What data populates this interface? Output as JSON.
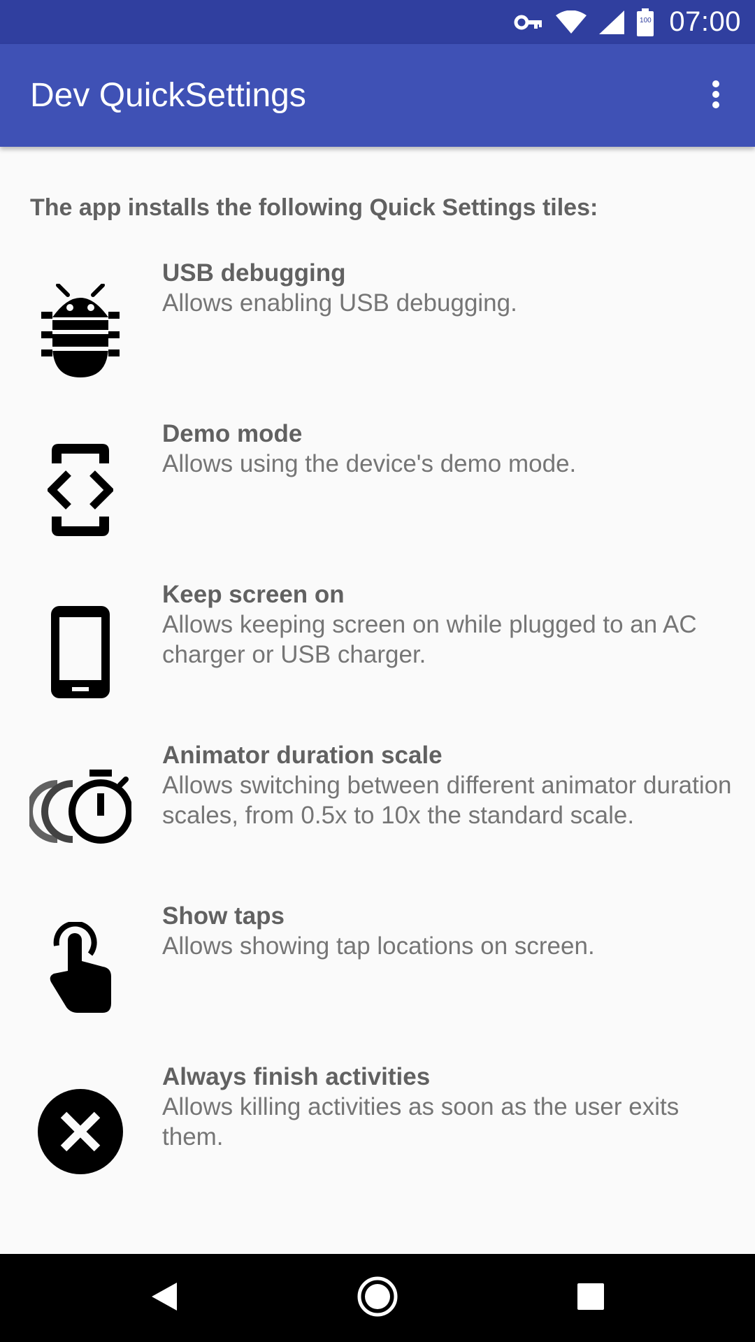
{
  "status_bar": {
    "time": "07:00",
    "battery_level": "100",
    "icons": [
      "vpn-key-icon",
      "wifi-icon",
      "cell-signal-icon",
      "battery-icon"
    ]
  },
  "app_bar": {
    "title": "Dev QuickSettings",
    "overflow_icon": "more-vert-icon"
  },
  "content": {
    "intro": "The app installs the following Quick Settings tiles:",
    "tiles": [
      {
        "title": "USB debugging",
        "description": "Allows enabling USB debugging.",
        "icon": "bug-icon"
      },
      {
        "title": "Demo mode",
        "description": "Allows using the device's demo mode.",
        "icon": "developer-mode-icon"
      },
      {
        "title": "Keep screen on",
        "description": "Allows keeping screen on while plugged to an AC charger or USB charger.",
        "icon": "smartphone-icon"
      },
      {
        "title": "Animator duration scale",
        "description": "Allows switching between different animator duration scales, from 0.5x to 10x the standard scale.",
        "icon": "animator-timer-icon"
      },
      {
        "title": "Show taps",
        "description": "Allows showing tap locations on screen.",
        "icon": "touch-app-icon"
      },
      {
        "title": "Always finish activities",
        "description": "Allows killing activities as soon as the user exits them.",
        "icon": "cancel-circle-icon"
      }
    ]
  },
  "nav_bar": {
    "icons": [
      "back-icon",
      "home-icon",
      "recents-icon"
    ]
  },
  "colors": {
    "status_bar": "#303f9f",
    "app_bar": "#3f51b5",
    "background": "#fafafa",
    "title_text": "#616161",
    "body_text": "#757575"
  }
}
